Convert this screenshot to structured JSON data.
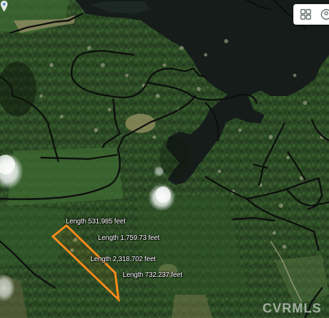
{
  "map": {
    "type": "satellite",
    "measurement_color": "#ff8c1a",
    "measurements": [
      {
        "text": "Length 531.985 feet"
      },
      {
        "text": "Length 1,759.73 feet"
      },
      {
        "text": "Length 2,318.702 feet"
      },
      {
        "text": "Length 732.237 feet"
      }
    ]
  },
  "controls": {
    "map_layers_icon": "grid-layers-icon",
    "overflow_icon": "map-option-icon"
  },
  "watermark": {
    "text": "CVRMLS"
  }
}
